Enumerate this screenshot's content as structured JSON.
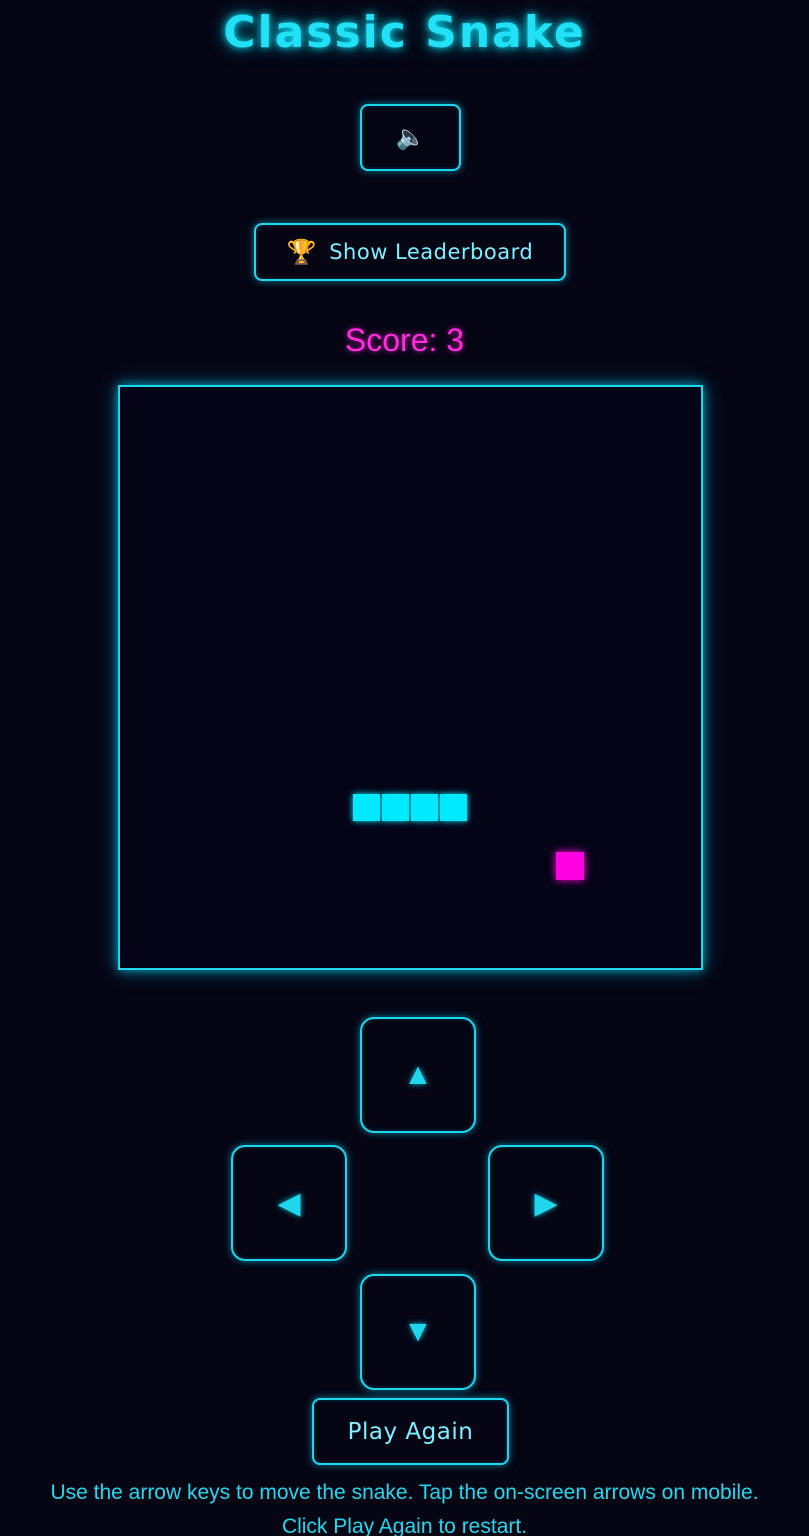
{
  "game": {
    "title": "Classic Snake",
    "sound_icon": "🔈",
    "leaderboard_icon": "🏆",
    "leaderboard_label": "Show Leaderboard",
    "score_text": "Score: 3",
    "play_again_label": "Play Again",
    "instructions_line1": "Use the arrow keys to move the snake. Tap the on-screen arrows on mobile.",
    "instructions_line2": "Click Play Again to restart."
  },
  "controls": {
    "up": "▲",
    "left": "◀",
    "right": "▶",
    "down": "▼"
  },
  "board": {
    "grid_cols": 20,
    "grid_rows": 20,
    "snake": [
      [
        8,
        14
      ],
      [
        9,
        14
      ],
      [
        10,
        14
      ],
      [
        11,
        14
      ]
    ],
    "food": [
      15,
      16
    ],
    "snake_color": "#00eaff",
    "food_color": "#ff00e0"
  },
  "colors": {
    "accent": "#22e0f5",
    "score": "#ff2bdc",
    "background": "#050514"
  }
}
